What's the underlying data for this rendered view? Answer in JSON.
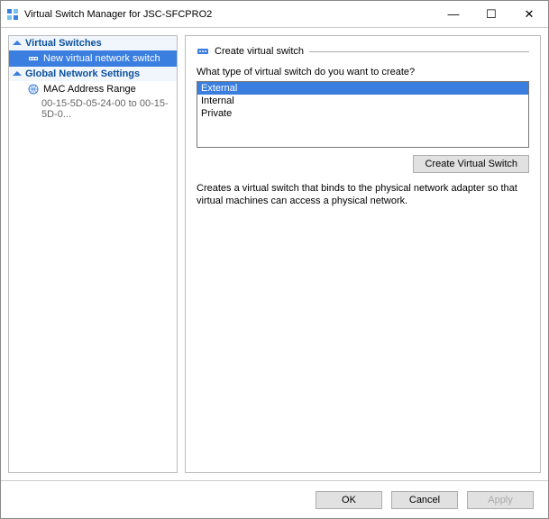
{
  "title": "Virtual Switch Manager for JSC-SFCPRO2",
  "sidebar": {
    "section1": {
      "label": "Virtual Switches",
      "item": "New virtual network switch"
    },
    "section2": {
      "label": "Global Network Settings",
      "item": "MAC Address Range",
      "sub": "00-15-5D-05-24-00 to 00-15-5D-0..."
    }
  },
  "panel": {
    "groupTitle": "Create virtual switch",
    "question": "What type of virtual switch do you want to create?",
    "options": [
      "External",
      "Internal",
      "Private"
    ],
    "createBtn": "Create Virtual Switch",
    "description": "Creates a virtual switch that binds to the physical network adapter so that virtual machines can access a physical network."
  },
  "footer": {
    "ok": "OK",
    "cancel": "Cancel",
    "apply": "Apply"
  }
}
